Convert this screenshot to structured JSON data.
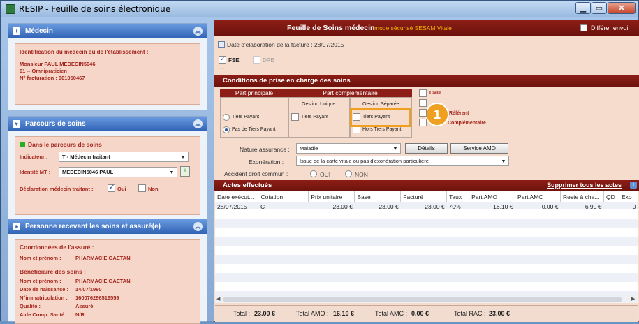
{
  "window": {
    "title": "RESIP - Feuille de soins électronique"
  },
  "medecin": {
    "header": "Médecin",
    "section_title": "Identification du médecin ou de l'établissement :",
    "name": "Monsieur PAUL MEDECIN5046",
    "specialty": "01 -- Omnipraticien",
    "facturation": "N° facturation : 001050467"
  },
  "parcours": {
    "header": "Parcours de soins",
    "status": "Dans le parcours de soins",
    "indicateur_label": "Indicateur :",
    "indicateur_value": "T - Médecin traitant",
    "identite_label": "Identité MT :",
    "identite_value": "MEDECIN5046 PAUL",
    "declaration_label": "Déclaration médecin traitant :",
    "oui": "Oui",
    "non": "Non"
  },
  "personne": {
    "header": "Personne recevant les soins et assuré(e)",
    "coord_title": "Coordonnées de l'assuré :",
    "nom_label": "Nom et prénom :",
    "nom_value": "PHARMACIE GAETAN",
    "benef_title": "Bénéficiaire des soins :",
    "rows": [
      {
        "label": "Nom et prénom :",
        "value": "PHARMACIE GAETAN"
      },
      {
        "label": "Date de naissance :",
        "value": "14/07/1960"
      },
      {
        "label": "N°immatriculation :",
        "value": "160076296519559"
      },
      {
        "label": "Qualité :",
        "value": "Assuré"
      },
      {
        "label": "Aide Comp. Santé :",
        "value": "N/R"
      }
    ]
  },
  "feuille": {
    "title": "Feuille de Soins médecin",
    "mode": "mode sécurisé SESAM Vitale",
    "differer": "Différer envoi",
    "date_label": "Date d'élaboration de la facture : 28/07/2015",
    "fse": "FSE",
    "dre": "DRE",
    "dashes": "---"
  },
  "conditions": {
    "header": "Conditions de prise en charge des soins",
    "part_principale": "Part principale",
    "part_complementaire": "Part complémentaire",
    "gestion_unique": "Gestion Unique",
    "gestion_separee": "Gestion Séparée",
    "tiers_payant": "Tiers Payant",
    "pas_tiers_payant": "Pas de Tiers Payant",
    "hors_tiers_payant": "Hors Tiers Payant",
    "cmu": "CMU",
    "referent": "Référent",
    "complementaire": "Complémentaire",
    "badge": "1"
  },
  "nature": {
    "label": "Nature assurance :",
    "value": "Maladie",
    "details_btn": "Détails",
    "service_btn": "Service AMO"
  },
  "exoneration": {
    "label": "Exonération :",
    "value": "Issue de la carte vitale ou pas d'exonération particulière"
  },
  "accident": {
    "label": "Accident droit commun :",
    "oui": "OUI",
    "non": "NON"
  },
  "actes": {
    "header": "Actes effectués",
    "delete_link": "Supprimer tous les actes",
    "columns": [
      "Date exécut...",
      "Cotation",
      "Prix unitaire",
      "Base",
      "Facturé",
      "Taux",
      "Part AMO",
      "Part AMC",
      "Reste à cha...",
      "QD",
      "Exo"
    ],
    "rows": [
      [
        "28/07/2015",
        "C",
        "23.00 €",
        "23.00 €",
        "23.00 €",
        "70%",
        "16.10 €",
        "0.00 €",
        "6.90 €",
        "",
        "0"
      ]
    ]
  },
  "totals": {
    "total_label": "Total :",
    "total_value": "23.00 €",
    "amo_label": "Total AMO :",
    "amo_value": "16.10 €",
    "amc_label": "Total AMC :",
    "amc_value": "0.00 €",
    "rac_label": "Total RAC :",
    "rac_value": "23.00 €"
  },
  "colors": {
    "accent": "#8c1e17",
    "panel_blue": "#2f62b4",
    "highlight": "#f0a020"
  }
}
